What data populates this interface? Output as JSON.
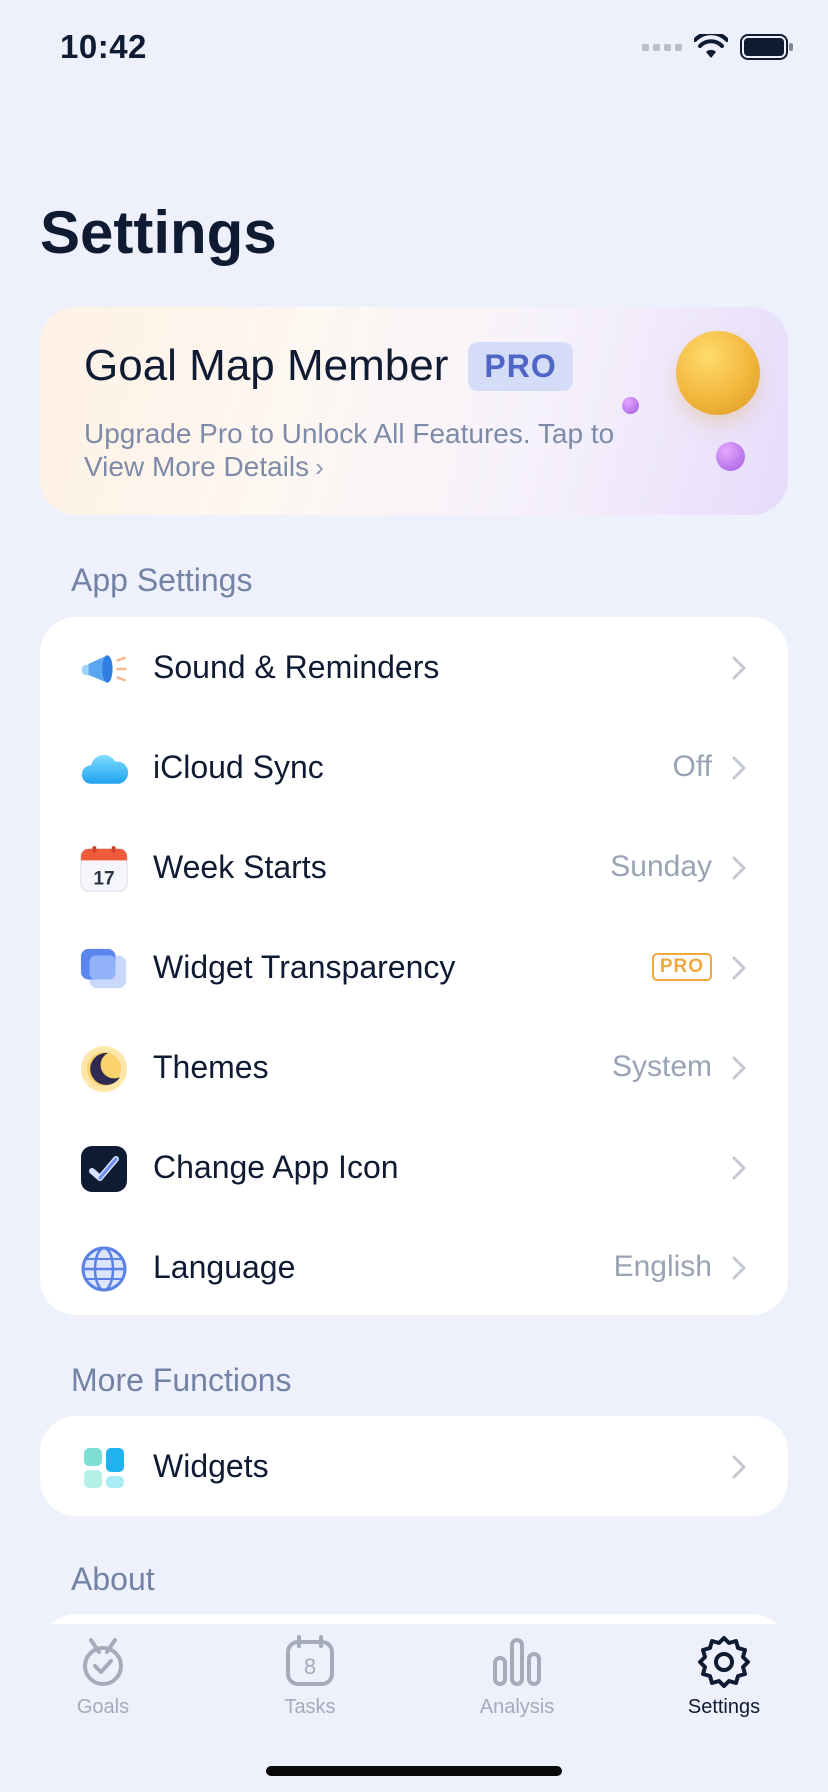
{
  "status_bar": {
    "time": "10:42"
  },
  "page": {
    "title": "Settings"
  },
  "pro_card": {
    "title": "Goal Map Member",
    "badge": "PRO",
    "subtitle": "Upgrade Pro to Unlock All Features. Tap to View More Details",
    "chevron": "›"
  },
  "sections": {
    "app_settings": "App Settings",
    "more_functions": "More Functions",
    "about": "About"
  },
  "app_settings_rows": [
    {
      "icon": "megaphone-icon",
      "label": "Sound & Reminders",
      "value": ""
    },
    {
      "icon": "cloud-icon",
      "label": "iCloud Sync",
      "value": "Off"
    },
    {
      "icon": "calendar-icon",
      "label": "Week Starts",
      "value": "Sunday",
      "icon_text": "17"
    },
    {
      "icon": "widget-transparency-icon",
      "label": "Widget Transparency",
      "badge": "PRO"
    },
    {
      "icon": "moon-icon",
      "label": "Themes",
      "value": "System"
    },
    {
      "icon": "app-icon-check-icon",
      "label": "Change App Icon",
      "value": ""
    },
    {
      "icon": "globe-icon",
      "label": "Language",
      "value": "English"
    }
  ],
  "more_functions_rows": [
    {
      "icon": "widgets-grid-icon",
      "label": "Widgets"
    }
  ],
  "tab_bar": {
    "tabs": [
      {
        "label": "Goals",
        "icon": "medal-icon",
        "active": false
      },
      {
        "label": "Tasks",
        "icon": "calendar-8-icon",
        "active": false,
        "icon_text": "8"
      },
      {
        "label": "Analysis",
        "icon": "bar-chart-icon",
        "active": false
      },
      {
        "label": "Settings",
        "icon": "gear-icon",
        "active": true
      }
    ]
  },
  "colors": {
    "background": "#eef1fb",
    "accent_blue": "#4f66c7",
    "pro_orange": "#f0a93c",
    "secondary_text": "#7283a6"
  }
}
